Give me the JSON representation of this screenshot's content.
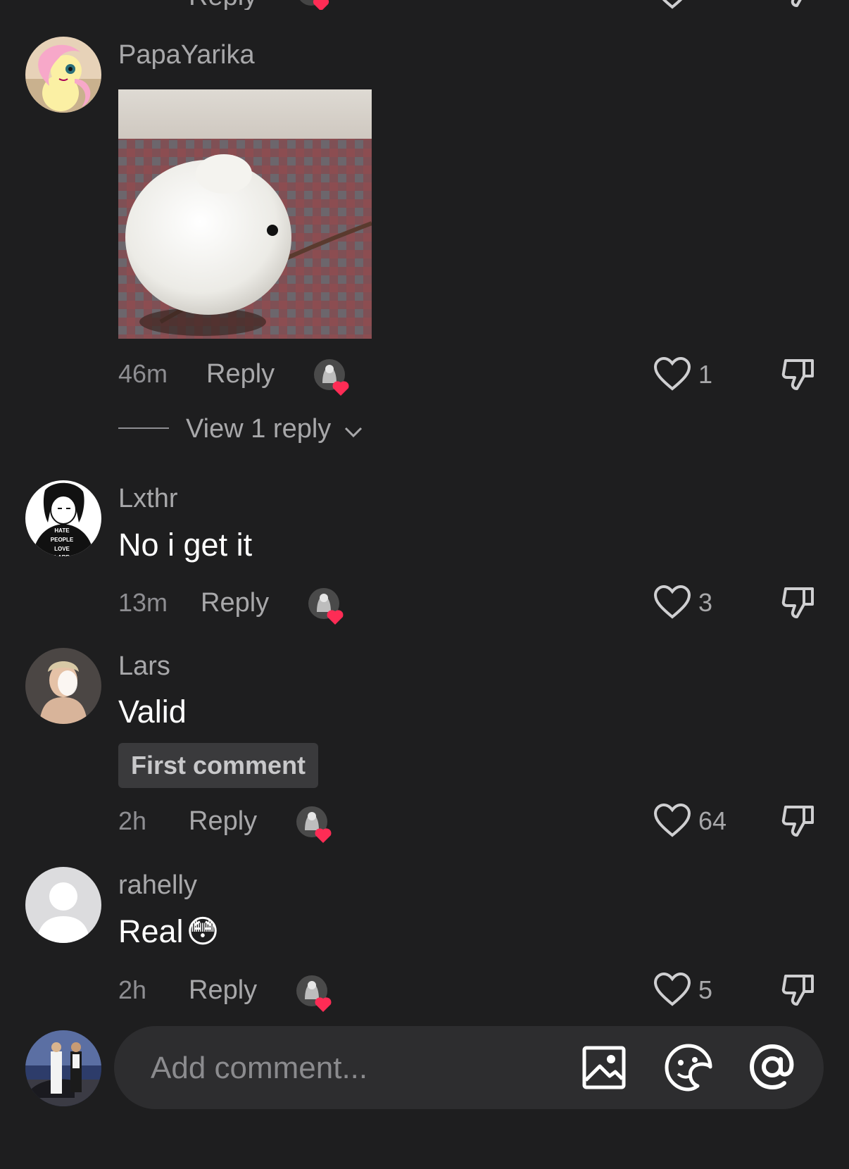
{
  "top_partial": {
    "reply_label": "Reply"
  },
  "comments": [
    {
      "username": "PapaYarika",
      "text": "",
      "time": "46m",
      "reply_label": "Reply",
      "likes": "1",
      "has_image": true,
      "view_replies": "View 1 reply"
    },
    {
      "username": "Lxthr",
      "text": "No i get it",
      "time": "13m",
      "reply_label": "Reply",
      "likes": "3",
      "avatar_text_1": "HATE PEOPLE",
      "avatar_text_2": "LOVE LARP"
    },
    {
      "username": "Lars",
      "text": "Valid",
      "badge": "First comment",
      "time": "2h",
      "reply_label": "Reply",
      "likes": "64"
    },
    {
      "username": "rahelly",
      "text": "Real",
      "emoji": "😳",
      "time": "2h",
      "reply_label": "Reply",
      "likes": "5"
    }
  ],
  "composer": {
    "placeholder": "Add comment..."
  },
  "icons": {
    "like": "heart-outline-icon",
    "dislike": "thumbs-down-icon",
    "creator_like": "creator-liked-badge-icon",
    "image": "image-icon",
    "sticker": "sticker-icon",
    "mention": "at-mention-icon",
    "chevron": "chevron-down-icon"
  },
  "colors": {
    "background": "#1e1e1f",
    "heart_red": "#fe2c55",
    "muted_text": "#a8a8aa"
  }
}
